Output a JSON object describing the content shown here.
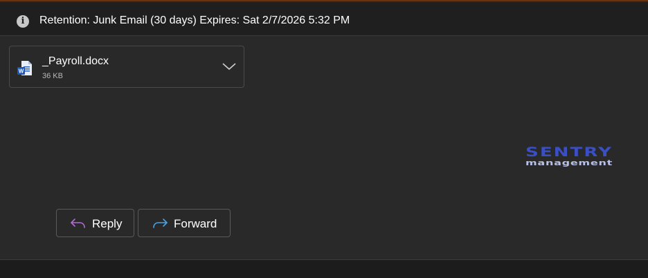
{
  "retention": {
    "icon": "info-icon",
    "text": "Retention: Junk Email (30 days) Expires: Sat 2/7/2026 5:32 PM"
  },
  "attachment": {
    "icon": "word-document-icon",
    "name": "_Payroll.docx",
    "size": "36 KB"
  },
  "logo": {
    "line1": "SENTRY",
    "line2": "management",
    "color": "#3a4fc4"
  },
  "actions": {
    "reply_label": "Reply",
    "forward_label": "Forward",
    "reply_icon_color": "#b56bd1",
    "forward_icon_color": "#4aa3e0"
  },
  "colors": {
    "background": "#292929",
    "bar": "#1f1f1f",
    "accent": "#7a3a10"
  }
}
